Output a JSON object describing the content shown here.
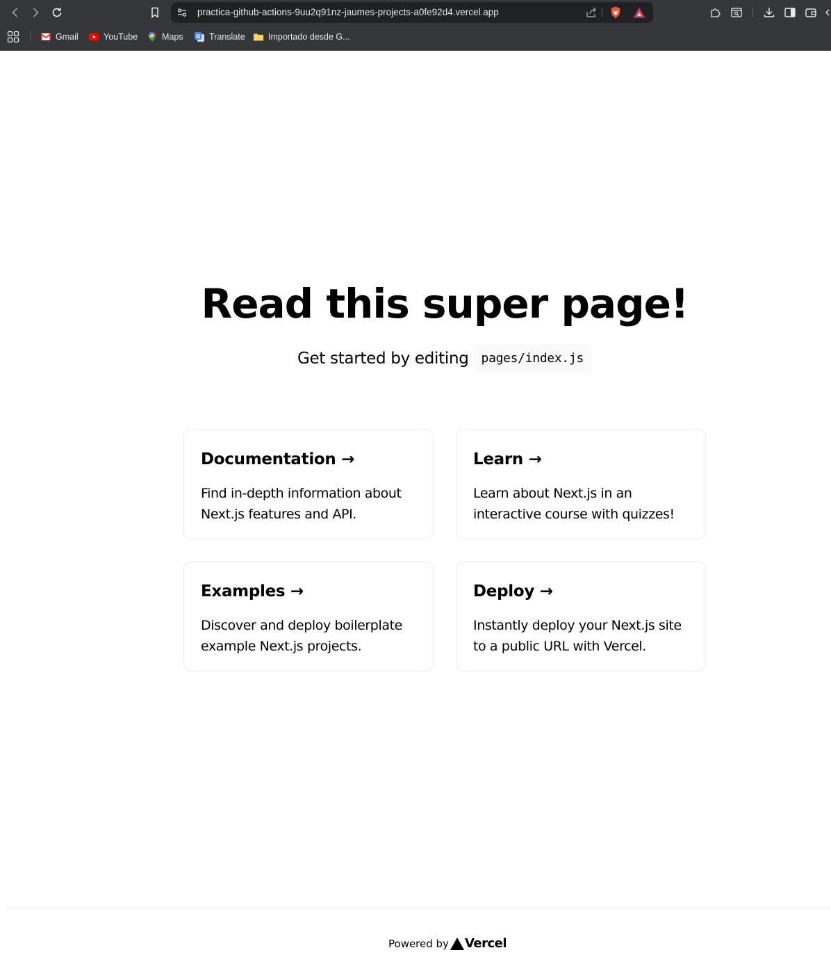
{
  "browser": {
    "url": "practica-github-actions-9uu2q91nz-jaumes-projects-a0fe92d4.vercel.app",
    "bookmarks": [
      {
        "label": "Gmail",
        "icon": "gmail-icon"
      },
      {
        "label": "YouTube",
        "icon": "youtube-icon"
      },
      {
        "label": "Maps",
        "icon": "maps-icon"
      },
      {
        "label": "Translate",
        "icon": "translate-icon"
      },
      {
        "label": "Importado desde G...",
        "icon": "folder-icon"
      }
    ],
    "colors": {
      "chrome": "#35363a",
      "omnibox": "#202124",
      "text": "#e8eaed"
    }
  },
  "page": {
    "title": "Read this super page!",
    "subtitle_text": "Get started by editing",
    "subtitle_code": "pages/index.js",
    "cards": [
      {
        "title": "Documentation →",
        "description": "Find in-depth information about Next.js features and API."
      },
      {
        "title": "Learn →",
        "description": "Learn about Next.js in an interactive course with quizzes!"
      },
      {
        "title": "Examples →",
        "description": "Discover and deploy boilerplate example Next.js projects."
      },
      {
        "title": "Deploy →",
        "description": "Instantly deploy your Next.js site to a public URL with Vercel."
      }
    ],
    "footer": {
      "powered_by": "Powered by",
      "brand": "Vercel"
    }
  }
}
